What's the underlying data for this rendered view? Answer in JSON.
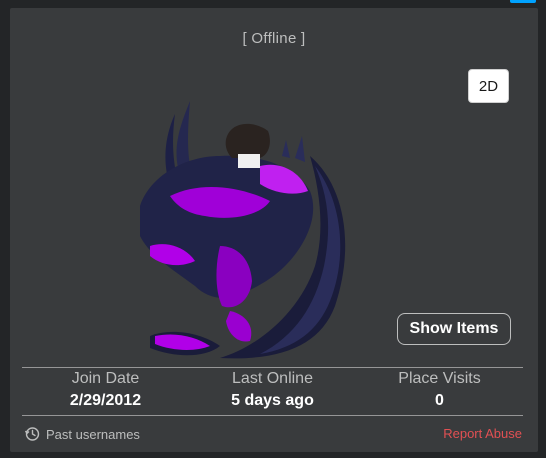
{
  "profile": {
    "status": "[ Offline ]",
    "toggle_view_label": "2D",
    "show_items_label": "Show Items"
  },
  "stats": [
    {
      "label": "Join Date",
      "value": "2/29/2012"
    },
    {
      "label": "Last Online",
      "value": "5 days ago"
    },
    {
      "label": "Place Visits",
      "value": "0"
    }
  ],
  "footer": {
    "past_usernames_label": "Past usernames",
    "past_usernames_icon": "history-clock-icon",
    "report_label": "Report Abuse"
  },
  "colors": {
    "background": "#232527",
    "panel": "#393b3d",
    "report": "#e15053",
    "accent": "#00a2ff",
    "avatar_purple": "#b100e8"
  }
}
